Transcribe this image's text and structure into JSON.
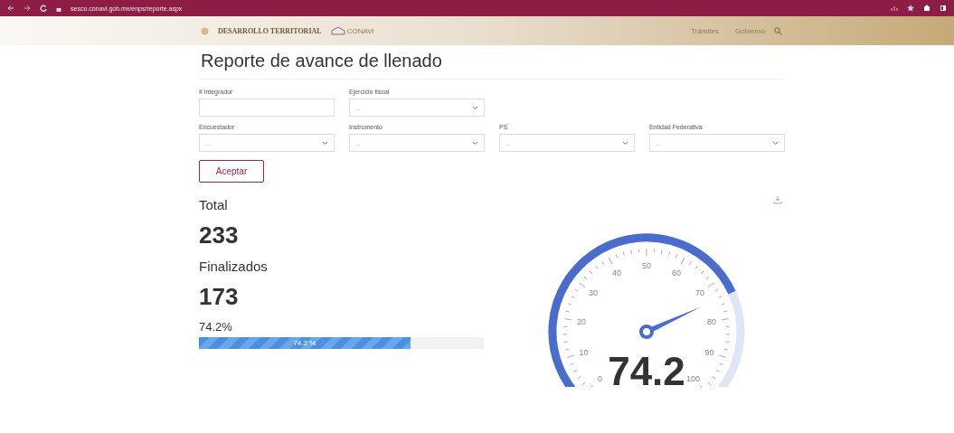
{
  "browser": {
    "url": "sesco.conavi.gob.mx/enps/reporte.aspx"
  },
  "header": {
    "brand": "DESARROLLO TERRITORIAL",
    "logo_text": "CONAVI",
    "nav": [
      "Trámites",
      "Gobierno"
    ]
  },
  "title": "Reporte de avance de llenado",
  "filters": [
    {
      "kind": "input",
      "label": "# integrador"
    },
    {
      "kind": "select",
      "label": "Ejercicio fiscal",
      "value": "..."
    },
    {
      "kind": "break"
    },
    {
      "kind": "select",
      "label": "Encuestador",
      "value": "..."
    },
    {
      "kind": "select",
      "label": "Instrumento",
      "value": "..."
    },
    {
      "kind": "select",
      "label": "PS",
      "value": "..."
    },
    {
      "kind": "select",
      "label": "Entidad Federativa",
      "value": "..."
    }
  ],
  "accept_button": "Aceptar",
  "stats": [
    {
      "label": "Total",
      "value": "233"
    },
    {
      "label": "Finalizados",
      "value": "173"
    }
  ],
  "progress": {
    "label": "74.2%",
    "level": 0.742,
    "bar_text": "74.2 %"
  },
  "gauge": {
    "value": "74.2",
    "ticks": [
      "0",
      "10",
      "20",
      "30",
      "40",
      "50",
      "60",
      "70",
      "80",
      "90",
      "100"
    ]
  }
}
